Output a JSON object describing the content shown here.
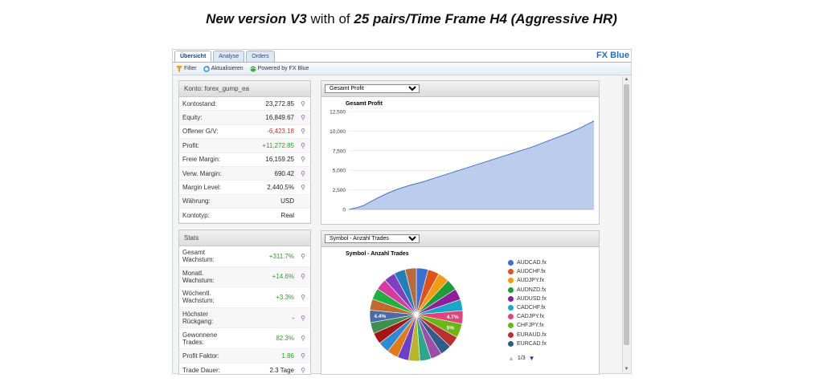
{
  "headline": {
    "part1": "New version V3",
    "part2": " with of ",
    "part3": "25 pairs/Time Frame H4 (Aggressive HR)"
  },
  "tabs": [
    {
      "label": "Übersicht",
      "active": true
    },
    {
      "label": "Analyse",
      "active": false
    },
    {
      "label": "Orders",
      "active": false
    }
  ],
  "brand": "FX Blue",
  "toolbar": {
    "filter": "Filter",
    "refresh": "Aktualisieren",
    "powered": "Powered by FX Blue"
  },
  "account": {
    "header": "Konto: forex_gump_ea",
    "rows": [
      {
        "label": "Kontostand:",
        "value": "23,272.85",
        "tone": ""
      },
      {
        "label": "Equity:",
        "value": "16,849.67",
        "tone": ""
      },
      {
        "label": "Offener G/V:",
        "value": "-6,423.18",
        "tone": "neg"
      },
      {
        "label": "Profit:",
        "value": "+11,272.85",
        "tone": "pos"
      },
      {
        "label": "Freie Margin:",
        "value": "16,159.25",
        "tone": ""
      },
      {
        "label": "Verw. Margin:",
        "value": "690.42",
        "tone": ""
      },
      {
        "label": "Margin Level:",
        "value": "2,440.5%",
        "tone": ""
      },
      {
        "label": "Währung:",
        "value": "USD",
        "tone": "",
        "nopin": true
      },
      {
        "label": "Kontotyp:",
        "value": "Real",
        "tone": "",
        "nopin": true
      }
    ]
  },
  "stats": {
    "header": "Stats",
    "rows": [
      {
        "label1": "Gesamt",
        "label2": "Wachstum:",
        "value": "+311.7%",
        "tone": "pos"
      },
      {
        "label1": "Monatl.",
        "label2": "Wachstum:",
        "value": "+14.6%",
        "tone": "pos"
      },
      {
        "label1": "Wöchentl.",
        "label2": "Wachstum:",
        "value": "+3.3%",
        "tone": "pos"
      },
      {
        "label1": "Höchster",
        "label2": "Rückgang:",
        "value": "-",
        "tone": ""
      },
      {
        "label1": "Gewonnene",
        "label2": "Trades:",
        "value": "82.3%",
        "tone": "pos"
      },
      {
        "label1": "Profit Faktor:",
        "label2": "",
        "value": "1.86",
        "tone": "pos"
      },
      {
        "label1": "Trade Dauer:",
        "label2": "",
        "value": "2.3 Tage",
        "tone": ""
      }
    ]
  },
  "profit_panel": {
    "select_value": "Gesamt Profit"
  },
  "symbol_panel": {
    "select_value": "Symbol - Anzahl Trades",
    "legend_pager": "1/3"
  },
  "chart_data": [
    {
      "type": "area",
      "title": "Gesamt Profit",
      "xlabel": "",
      "ylabel": "",
      "ylim": [
        0,
        12500
      ],
      "yticks": [
        "0",
        "2,500",
        "5,000",
        "7,500",
        "10,000",
        "12,500"
      ],
      "grid": true,
      "color": "#4472c4",
      "x": [
        0,
        0.03,
        0.06,
        0.09,
        0.12,
        0.16,
        0.2,
        0.25,
        0.3,
        0.35,
        0.4,
        0.45,
        0.5,
        0.55,
        0.6,
        0.65,
        0.7,
        0.75,
        0.8,
        0.85,
        0.9,
        0.95,
        1.0
      ],
      "values": [
        0,
        200,
        500,
        1000,
        1500,
        2100,
        2600,
        3100,
        3500,
        4000,
        4500,
        5000,
        5500,
        6000,
        6500,
        7000,
        7500,
        8000,
        8600,
        9200,
        9800,
        10500,
        11300
      ]
    },
    {
      "type": "pie",
      "title": "Symbol - Anzahl Trades",
      "legend_position": "right",
      "slices": [
        {
          "name": "AUDCAD.fx",
          "value": 4.2,
          "color": "#3b6fd6"
        },
        {
          "name": "AUDCHF.fx",
          "value": 4.0,
          "color": "#e0521a"
        },
        {
          "name": "AUDJPY.fx",
          "value": 4.0,
          "color": "#f39c12"
        },
        {
          "name": "AUDNZD.fx",
          "value": 4.0,
          "color": "#1e9c3a"
        },
        {
          "name": "AUDUSD.fx",
          "value": 4.0,
          "color": "#8e1e9c"
        },
        {
          "name": "CADCHF.fx",
          "value": 4.0,
          "color": "#1aa6c8"
        },
        {
          "name": "CADJPY.fx",
          "value": 4.7,
          "color": "#e0447a"
        },
        {
          "name": "CHFJPY.fx",
          "value": 5.0,
          "color": "#6ab814"
        },
        {
          "name": "EURAUD.fx",
          "value": 4.0,
          "color": "#b83030"
        },
        {
          "name": "EURCAD.fx",
          "value": 4.0,
          "color": "#305d8c"
        },
        {
          "name": "",
          "value": 4.0,
          "color": "#9c4fa8"
        },
        {
          "name": "",
          "value": 4.0,
          "color": "#2aa889"
        },
        {
          "name": "",
          "value": 4.0,
          "color": "#b9b62a"
        },
        {
          "name": "",
          "value": 4.0,
          "color": "#6a3fc9"
        },
        {
          "name": "",
          "value": 4.0,
          "color": "#e07a1a"
        },
        {
          "name": "",
          "value": 4.0,
          "color": "#2f8ad6"
        },
        {
          "name": "",
          "value": 4.0,
          "color": "#a61414"
        },
        {
          "name": "",
          "value": 4.0,
          "color": "#3f8f4f"
        },
        {
          "name": "",
          "value": 4.4,
          "color": "#4a6aa8"
        },
        {
          "name": "",
          "value": 4.0,
          "color": "#c06a30"
        },
        {
          "name": "",
          "value": 4.0,
          "color": "#20b040"
        },
        {
          "name": "",
          "value": 4.0,
          "color": "#d63ba0"
        },
        {
          "name": "",
          "value": 4.0,
          "color": "#7f3fbf"
        },
        {
          "name": "",
          "value": 4.0,
          "color": "#1f7fb8"
        },
        {
          "name": "",
          "value": 4.0,
          "color": "#b86a3a"
        }
      ],
      "data_labels": [
        {
          "slice": 6,
          "text": "4.7%"
        },
        {
          "slice": 7,
          "text": "5%"
        },
        {
          "slice": 18,
          "text": "4.4%"
        }
      ]
    }
  ]
}
